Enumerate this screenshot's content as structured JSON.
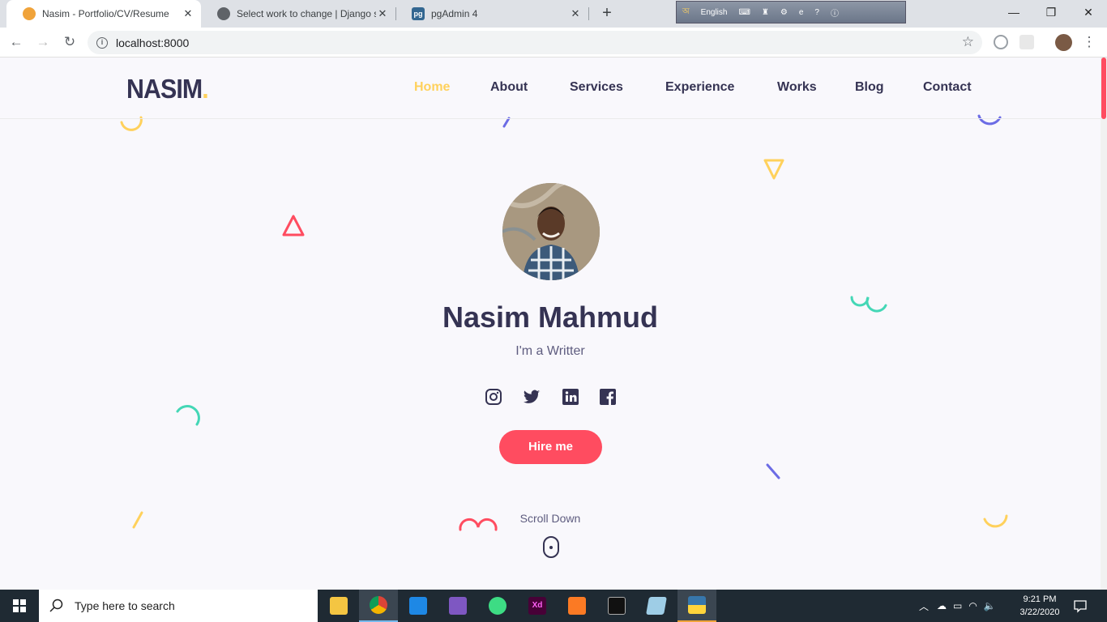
{
  "browser": {
    "tabs": [
      {
        "title": "Nasim - Portfolio/CV/Resume",
        "active": true
      },
      {
        "title": "Select work to change | Django site admin",
        "active": false
      },
      {
        "title": "pgAdmin 4",
        "active": false
      }
    ],
    "pgadmin_favicon": "pg",
    "address": "localhost:8000",
    "ext_language": "English",
    "new_tab_symbol": "+"
  },
  "site": {
    "logo": "NASIM",
    "logo_dot": ".",
    "menu": [
      "Home",
      "About",
      "Services",
      "Experience",
      "Works",
      "Blog",
      "Contact"
    ],
    "active_menu": "Home",
    "hero": {
      "name": "Nasim Mahmud",
      "subtitle": "I'm a Writter",
      "cta": "Hire me",
      "scroll_label": "Scroll Down"
    },
    "social_icons": [
      "instagram-icon",
      "twitter-icon",
      "linkedin-icon",
      "facebook-icon"
    ],
    "colors": {
      "accent": "#ffd15c",
      "primary": "#ff4c60",
      "text": "#353353",
      "purple": "#6c6ce5",
      "green": "#44d7b6"
    }
  },
  "taskbar": {
    "search_placeholder": "Type here to search",
    "apps": [
      "file-explorer",
      "chrome",
      "vscode",
      "visual-studio",
      "android-studio",
      "adobe-xd",
      "xampp",
      "cmd",
      "pgadmin",
      "python-idle"
    ],
    "xd_label": "Xd",
    "time": "9:21 PM",
    "date": "3/22/2020"
  }
}
